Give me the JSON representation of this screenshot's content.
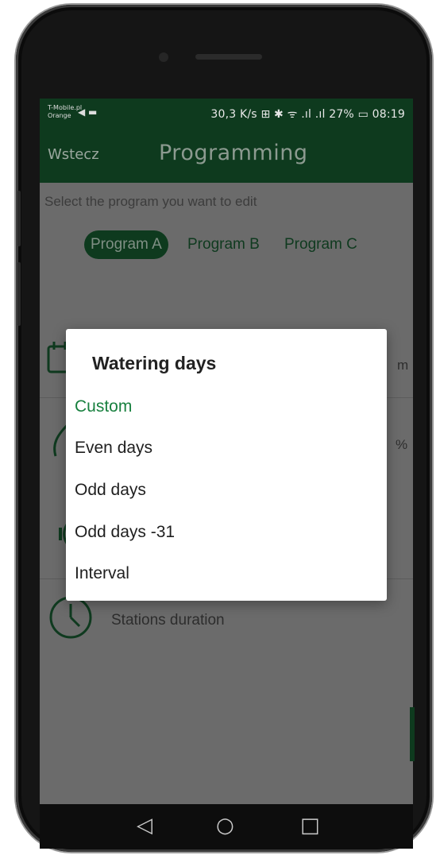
{
  "status_bar": {
    "carrier_line1": "T-Mobile.pl",
    "carrier_line2": "Orange",
    "carrier_icons": "◀ ▬",
    "right_text": "30,3 K/s ⊞ ✱ ᯤ .ıl .ıl 27% ▭ 08:19"
  },
  "app_bar": {
    "back_label": "Wstecz",
    "title": "Programming"
  },
  "content": {
    "hint": "Select the program you want to edit",
    "programs": [
      "Program A",
      "Program B",
      "Program C"
    ],
    "active_program": "Program A",
    "row_values": {
      "first_tail": "m",
      "second_tail": "%"
    },
    "stations_label": "Stations duration"
  },
  "dialog": {
    "title": "Watering days",
    "options": [
      "Custom",
      "Even days",
      "Odd days",
      "Odd days -31",
      "Interval"
    ],
    "selected": "Custom"
  },
  "colors": {
    "accent_dark_green": "#0e3a1e",
    "selected_green": "#18803f",
    "scrim_gray": "#6b6b6b"
  },
  "icons": {
    "calendar": "calendar-icon",
    "drop": "water-drop-icon",
    "pause": "pause-icon",
    "clock": "clock-icon",
    "nav_back": "◁",
    "nav_home": "○",
    "nav_recent": "□"
  }
}
